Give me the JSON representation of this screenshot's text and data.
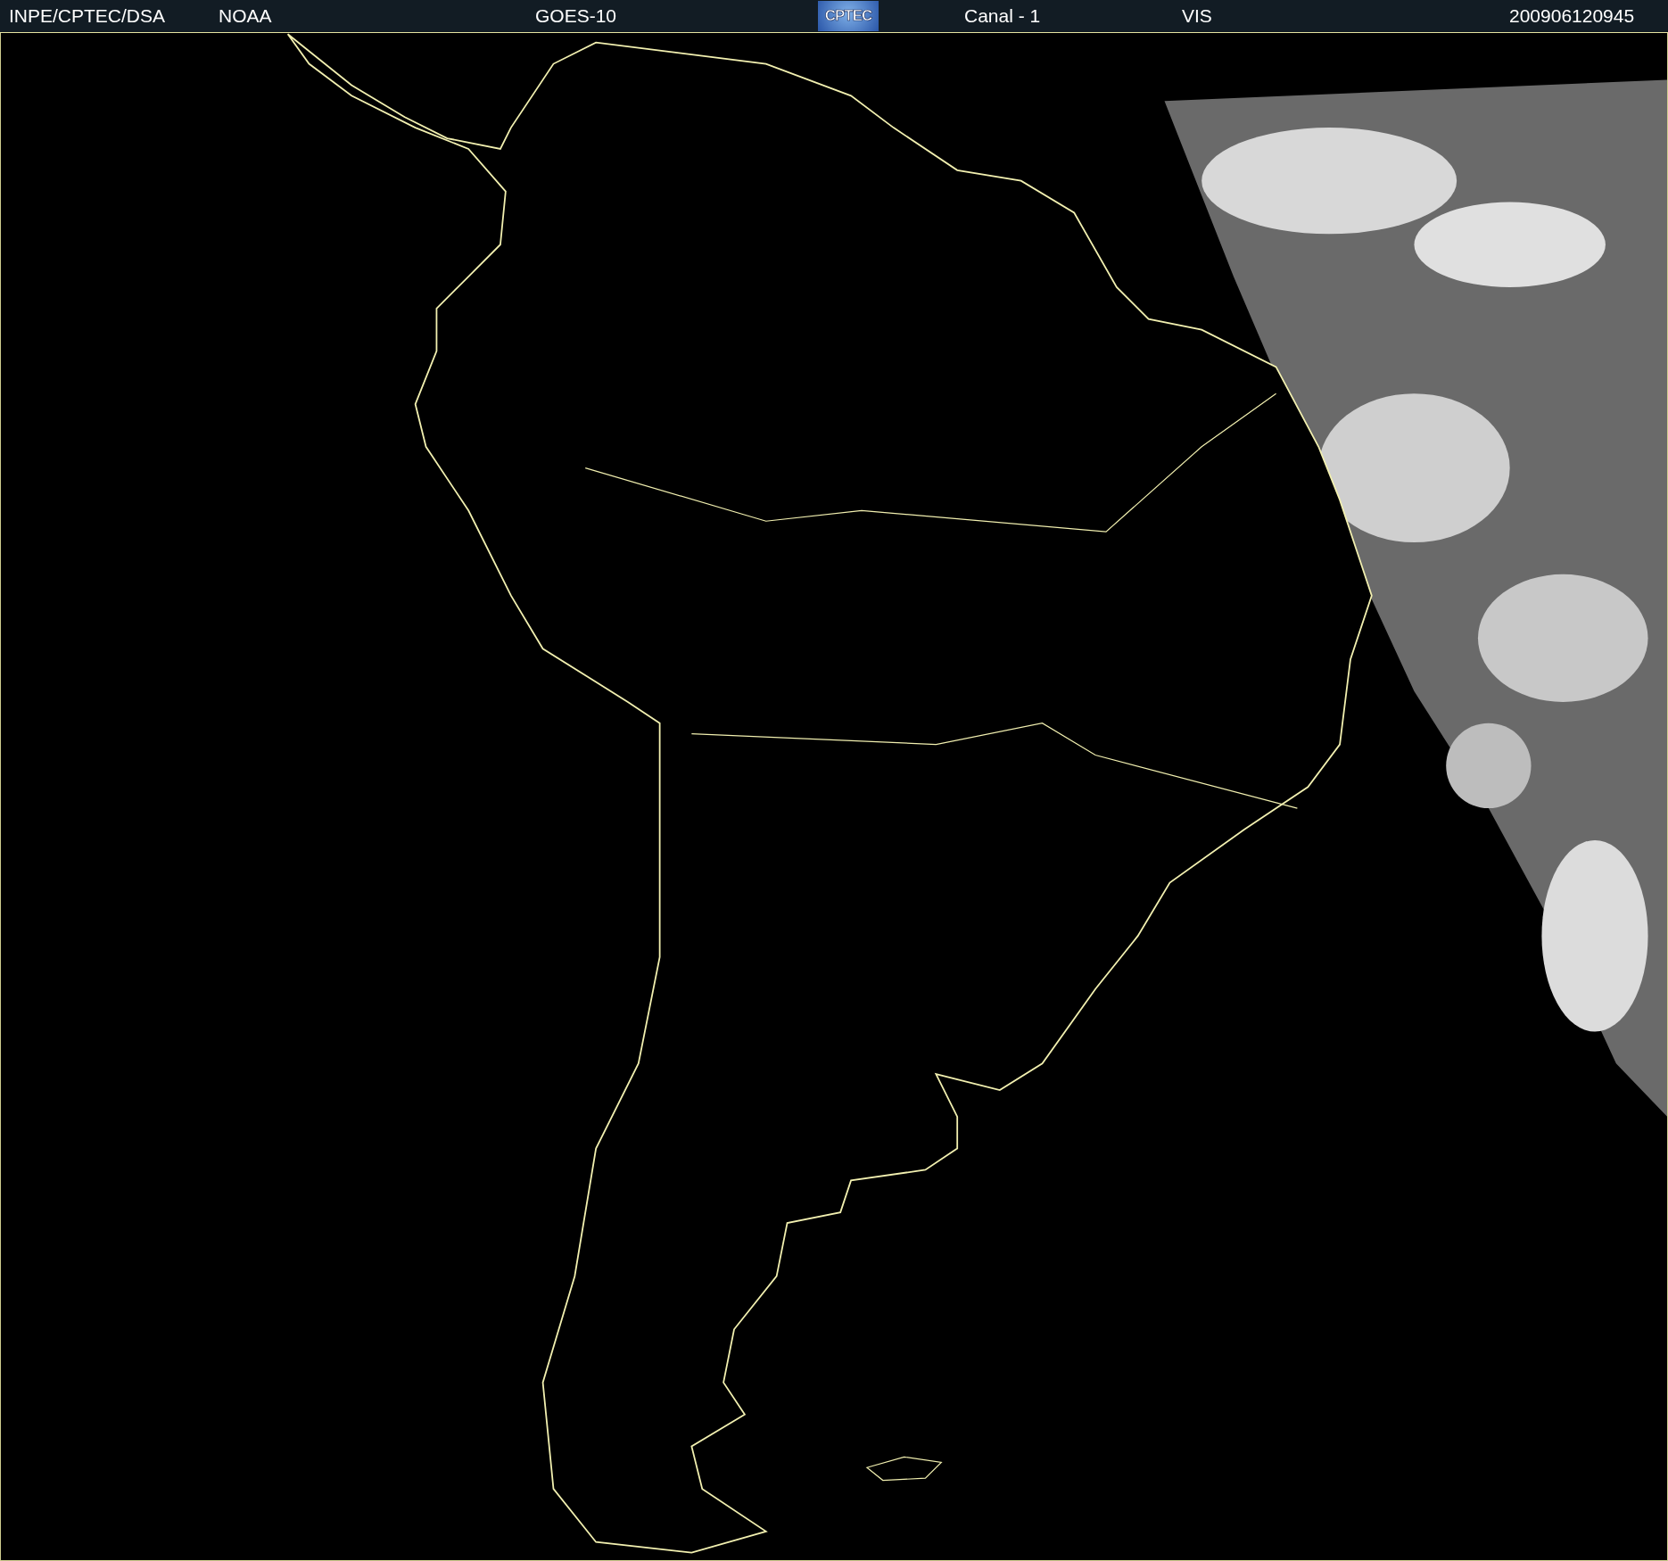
{
  "header": {
    "items": [
      {
        "kind": "text",
        "text": "INPE/CPTEC/DSA"
      },
      {
        "kind": "text",
        "text": "NOAA"
      },
      {
        "kind": "text",
        "text": "GOES-10"
      },
      {
        "kind": "logo",
        "text": "CPTEC"
      },
      {
        "kind": "text",
        "text": "Canal - 1"
      },
      {
        "kind": "text",
        "text": "VIS"
      },
      {
        "kind": "text",
        "text": "200906120945"
      }
    ]
  }
}
